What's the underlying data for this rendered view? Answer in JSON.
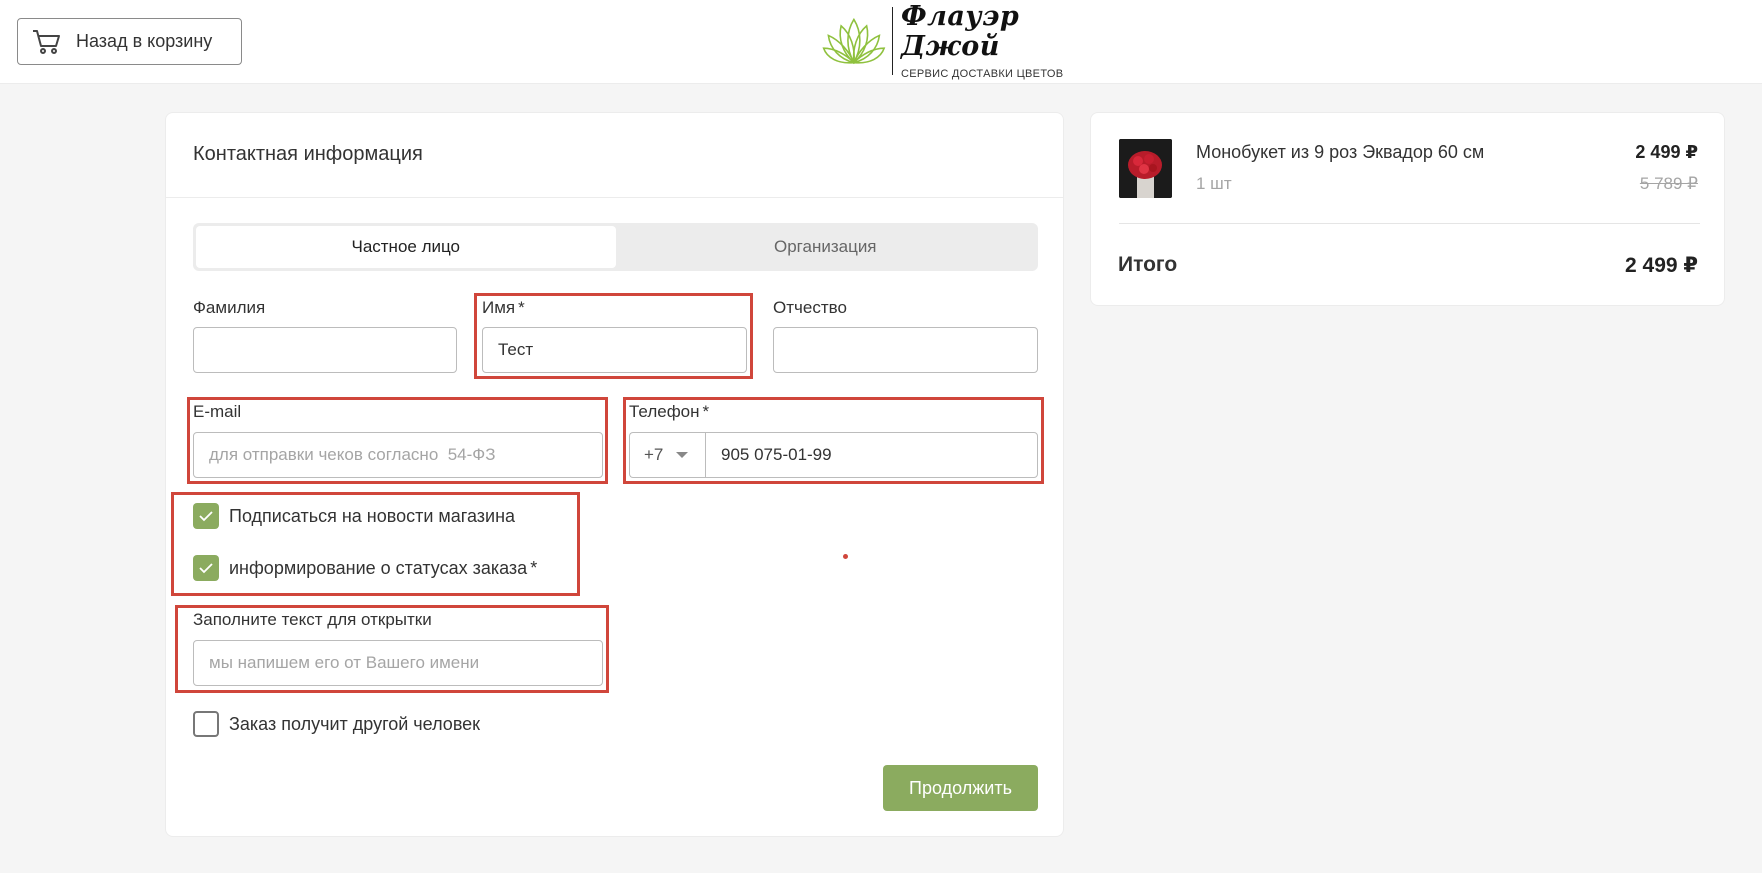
{
  "header": {
    "back_label": "Назад в корзину",
    "logo_name": "Флауэр Джой",
    "logo_tagline": "СЕРВИС ДОСТАВКИ ЦВЕТОВ"
  },
  "contact": {
    "title": "Контактная информация",
    "tabs": [
      {
        "label": "Частное лицо",
        "active": true
      },
      {
        "label": "Организация",
        "active": false
      }
    ],
    "fields": {
      "last_name": {
        "label": "Фамилия",
        "value": "",
        "placeholder": ""
      },
      "first_name": {
        "label": "Имя",
        "required_mark": "*",
        "value": "Тест",
        "placeholder": ""
      },
      "middle_name": {
        "label": "Отчество",
        "value": "",
        "placeholder": ""
      },
      "email": {
        "label": "E-mail",
        "value": "",
        "placeholder": "для отправки чеков согласно  54-ФЗ"
      },
      "phone": {
        "label": "Телефон",
        "required_mark": "*",
        "country_code": "+7",
        "value": "905 075-01-99"
      },
      "card_text": {
        "label": "Заполните текст для открытки",
        "value": "",
        "placeholder": "мы напишем его от Вашего имени"
      }
    },
    "checkboxes": {
      "newsletter": {
        "label": "Подписаться на новости магазина",
        "checked": true
      },
      "status": {
        "label": "информирование о статусах заказа",
        "required_mark": "*",
        "checked": true
      },
      "other_recipient": {
        "label": "Заказ получит другой человек",
        "checked": false
      }
    },
    "continue_label": "Продолжить"
  },
  "summary": {
    "item": {
      "name": "Монобукет из 9 роз Эквадор 60 см",
      "qty": "1 шт",
      "price": "2 499 ₽",
      "old_price": "5 789 ₽"
    },
    "total_label": "Итого",
    "total_value": "2 499 ₽"
  },
  "colors": {
    "accent": "#8bab5f",
    "highlight": "#d0463b"
  }
}
